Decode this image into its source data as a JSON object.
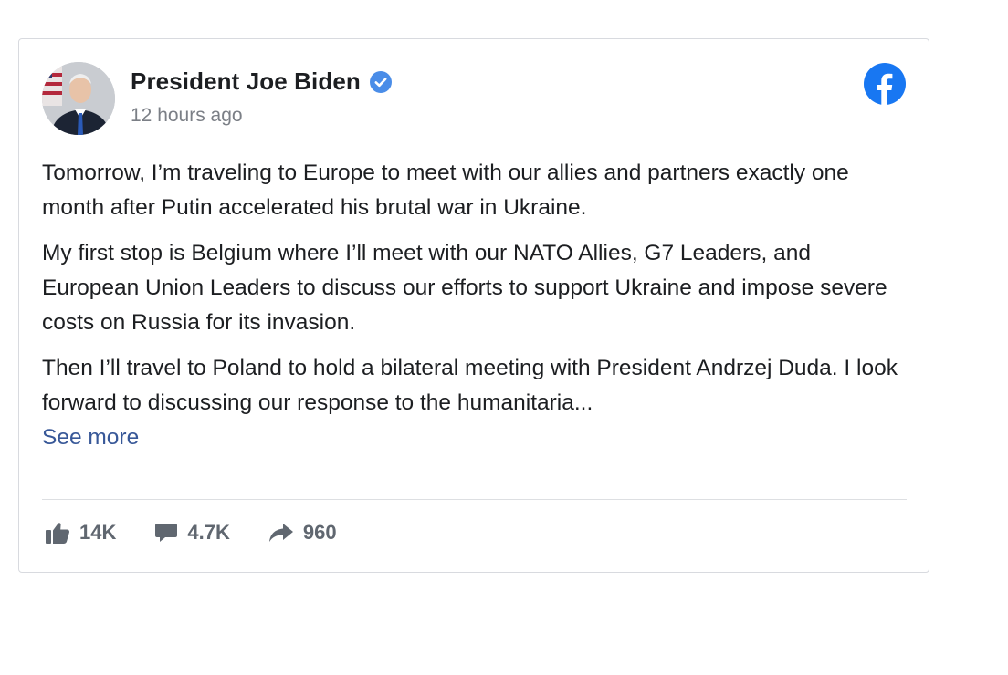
{
  "post": {
    "author": "President Joe Biden",
    "timestamp": "12 hours ago",
    "paragraphs": [
      "Tomorrow, I’m traveling to Europe to meet with our allies and partners exactly one month after Putin accelerated his brutal war in Ukraine.",
      "My first stop is Belgium where I’ll meet with our NATO Allies, G7 Leaders, and European Union Leaders to discuss our efforts to support Ukraine and impose severe costs on Russia for its invasion.",
      "Then I’ll travel to Poland to hold a bilateral meeting with President Andrzej Duda. I look forward to discussing our response to the humanitaria..."
    ],
    "see_more": "See more"
  },
  "stats": {
    "likes": "14K",
    "comments": "4.7K",
    "shares": "960"
  },
  "icons": {
    "verified": "verified-badge-icon",
    "platform": "facebook-logo-icon",
    "like": "thumbs-up-icon",
    "comment": "comment-bubble-icon",
    "share": "share-arrow-icon"
  },
  "colors": {
    "facebook_blue": "#1877f2",
    "verified_blue": "#4a8de8",
    "link_blue": "#385898",
    "text": "#1c1e21",
    "muted": "#606770"
  }
}
